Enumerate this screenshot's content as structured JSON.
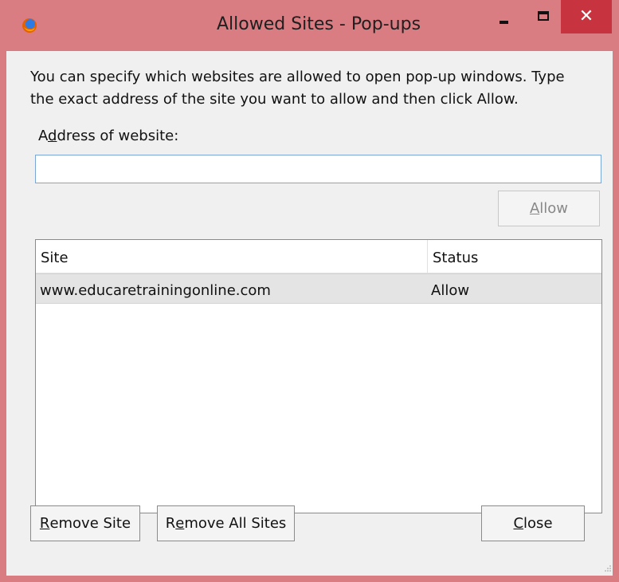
{
  "window": {
    "title": "Allowed Sites - Pop-ups",
    "close_symbol": "✕"
  },
  "content": {
    "instructions_line_1": "You can specify which websites are allowed to open pop-up windows. Type",
    "instructions_line_2": "the exact address of the site you want to allow and then click Allow.",
    "address_label_prefix": "A",
    "address_label_mnemonic": "d",
    "address_label_suffix": "dress of website:",
    "address_value": "",
    "allow_mnemonic": "A",
    "allow_suffix": "llow"
  },
  "table": {
    "headers": [
      "Site",
      "Status"
    ],
    "rows": [
      {
        "site": "www.educaretrainingonline.com",
        "status": "Allow"
      }
    ]
  },
  "buttons": {
    "remove_site_mnemonic": "R",
    "remove_site_suffix": "emove Site",
    "remove_all_prefix": "R",
    "remove_all_mnemonic": "e",
    "remove_all_suffix": "move All Sites",
    "close_mnemonic": "C",
    "close_suffix": "lose"
  },
  "icons": {
    "app": "firefox-icon",
    "minimize": "minimize-icon",
    "maximize": "maximize-icon",
    "resize": "resize-grip-icon"
  },
  "colors": {
    "window_frame": "#d97d83",
    "close_button": "#c7333e",
    "client_bg": "#f0f0f0",
    "selected_row": "#e4e4e4",
    "input_border": "#7aa7d6"
  }
}
